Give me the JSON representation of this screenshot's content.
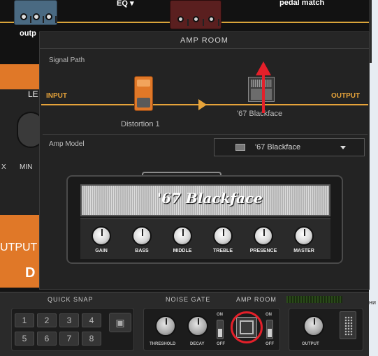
{
  "background": {
    "top_labels": {
      "eq": "EQ",
      "pedal_match": "pedal match",
      "output_fragment": "outp"
    },
    "side_labels": {
      "le": "LE",
      "x": "X",
      "min": "MIN",
      "output": "UTPUT",
      "d": "D"
    },
    "right_edge_text": "ни"
  },
  "modal": {
    "title": "AMP ROOM",
    "signal_path": {
      "label": "Signal Path",
      "input_label": "INPUT",
      "output_label": "OUTPUT",
      "pedal_name": "Distortion 1",
      "amp_name": "'67 Blackface"
    },
    "amp_model": {
      "label": "Amp Model",
      "selected": "'67 Blackface"
    },
    "amp": {
      "logo_text": "'67 Blackface",
      "knobs": [
        "GAIN",
        "BASS",
        "MIDDLE",
        "TREBLE",
        "PRESENCE",
        "MASTER"
      ]
    }
  },
  "bottom": {
    "quick_snap": {
      "label": "QUICK SNAP",
      "buttons": [
        "1",
        "2",
        "3",
        "4",
        "5",
        "6",
        "7",
        "8"
      ]
    },
    "noise_gate": {
      "label": "NOISE GATE",
      "threshold_label": "THRESHOLD",
      "decay_label": "DECAY",
      "on": "ON",
      "off": "OFF"
    },
    "amp_room": {
      "label": "AMP ROOM",
      "on": "ON",
      "off": "OFF"
    },
    "output": {
      "label": "OUTPUT"
    }
  },
  "colors": {
    "accent_orange": "#e6a33a",
    "annotation_red": "#e4202a",
    "pedal_orange": "#e07828"
  }
}
